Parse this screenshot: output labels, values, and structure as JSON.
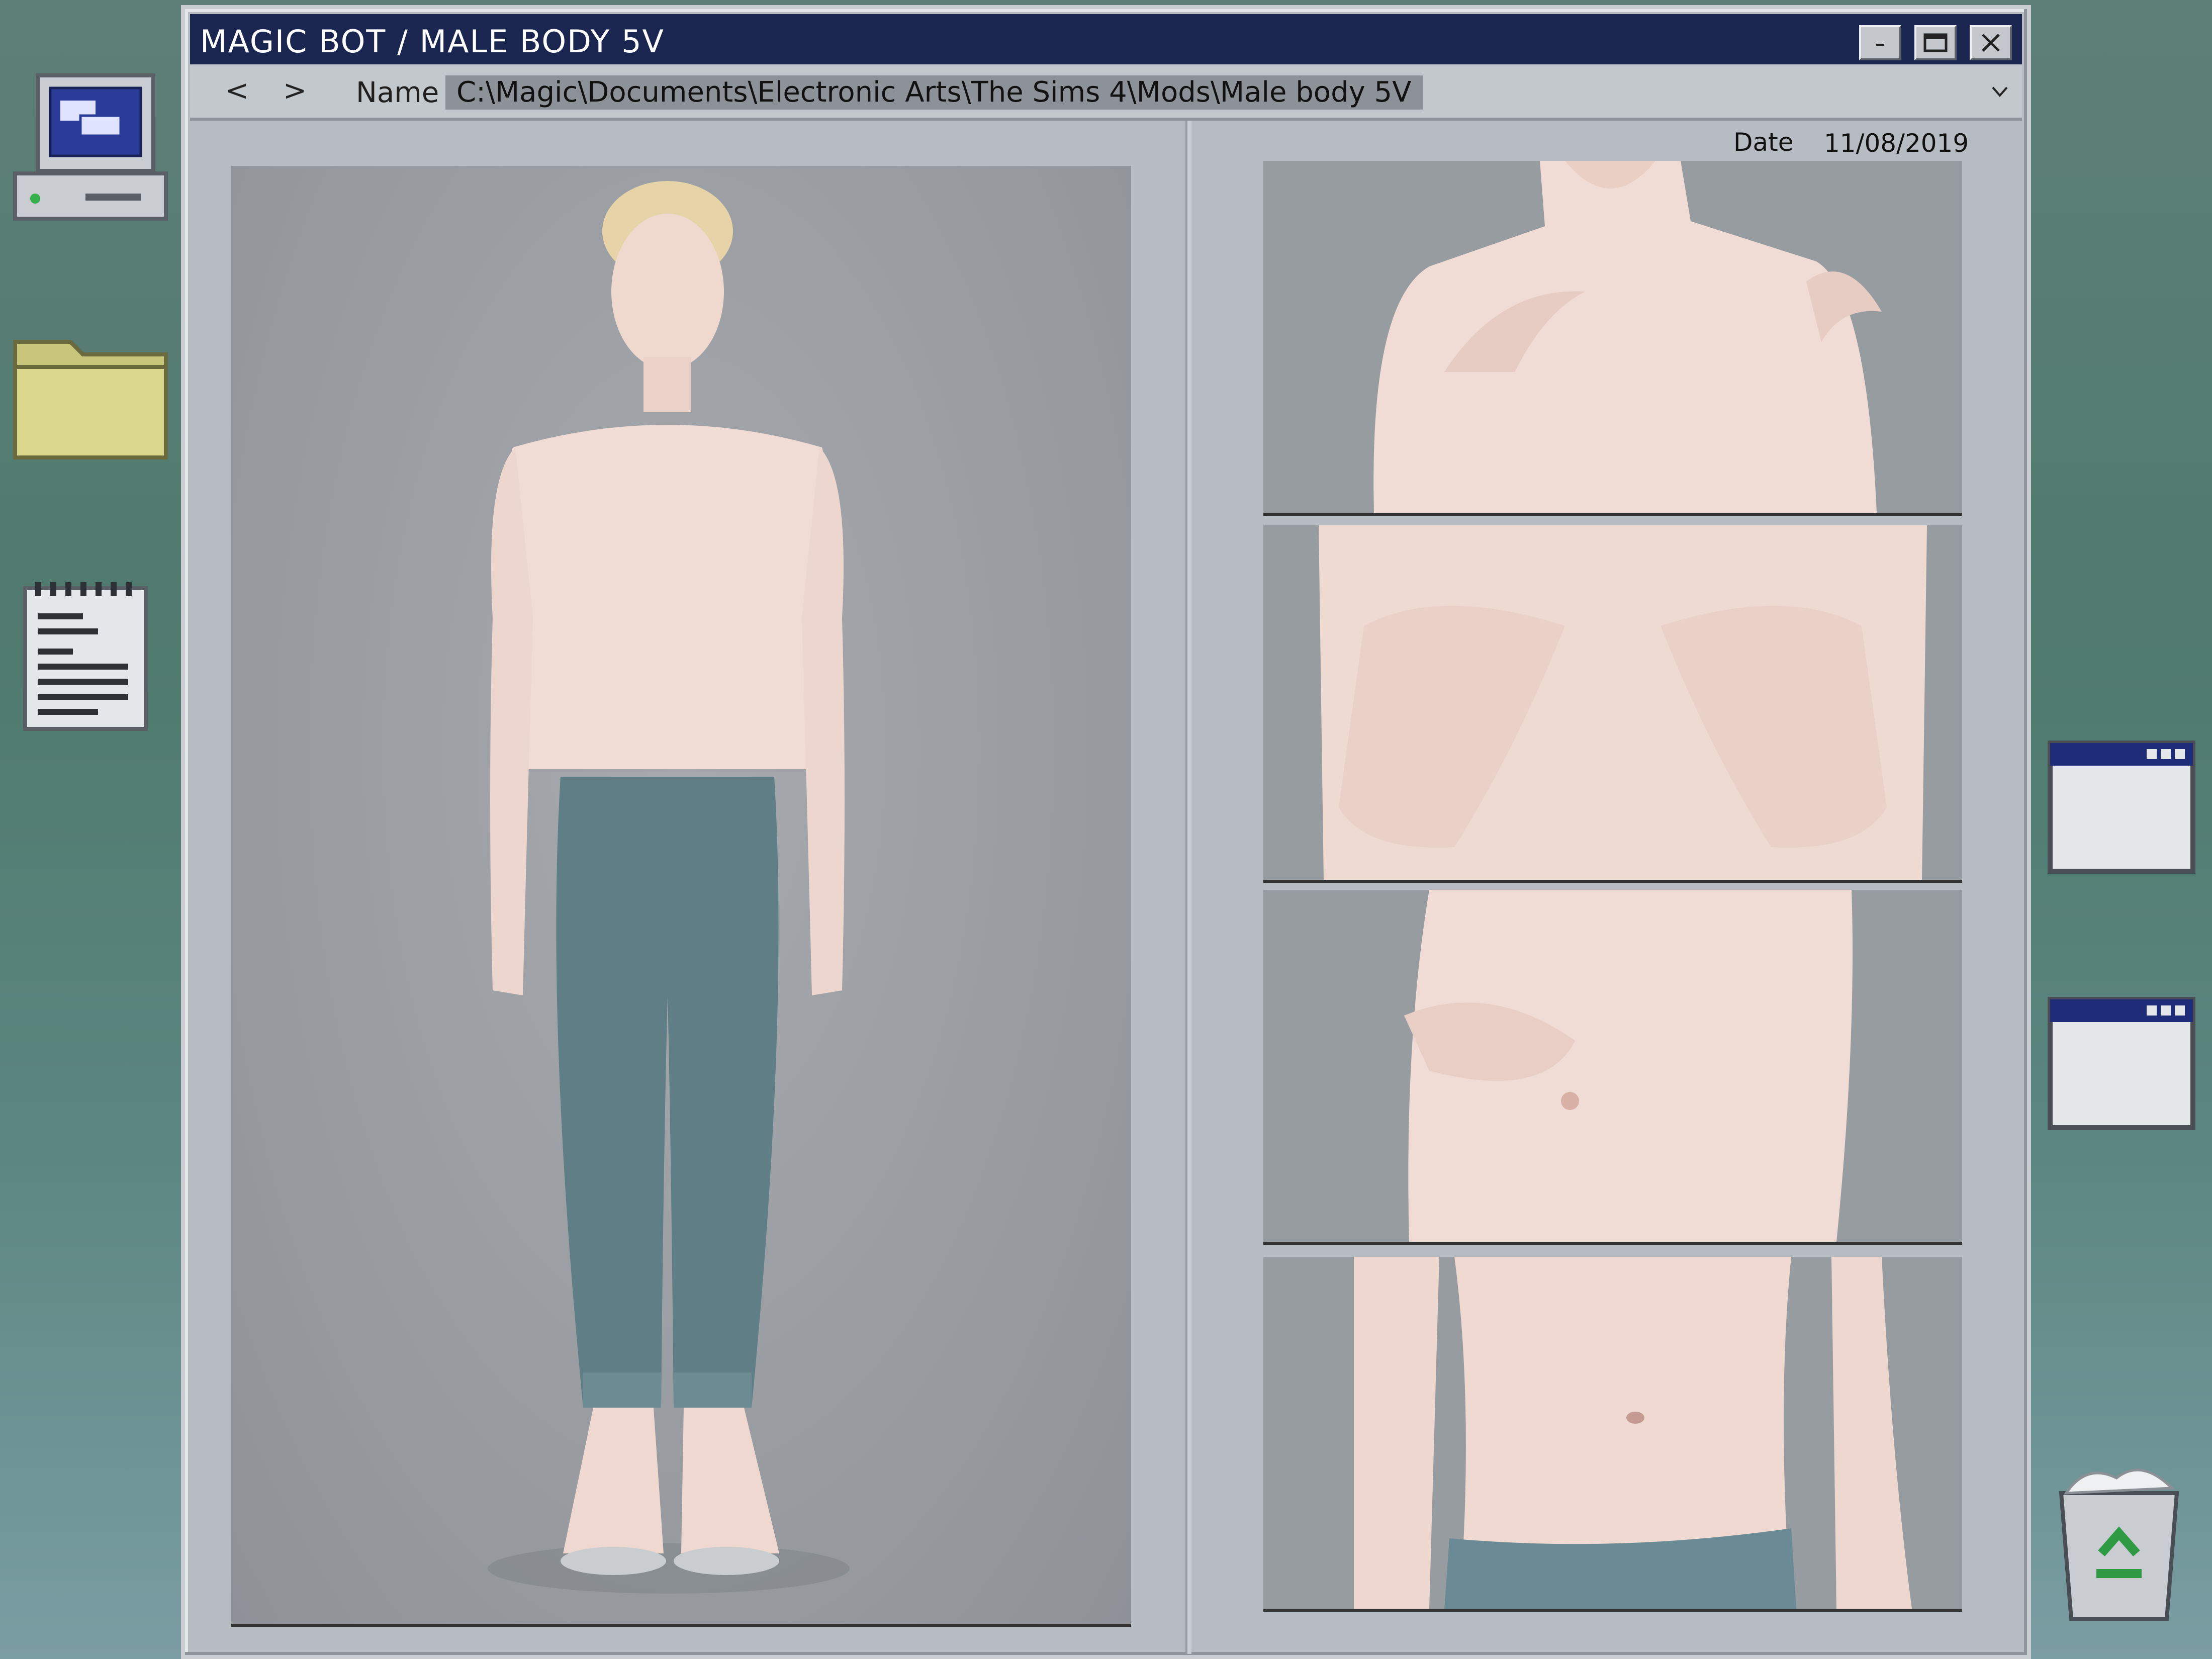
{
  "window": {
    "title": "MAGIC BOT  /  MALE BODY 5V",
    "buttons": {
      "minimize_icon": "minimize-icon",
      "maximize_icon": "maximize-icon",
      "close_icon": "close-icon"
    }
  },
  "address": {
    "back_glyph": "<",
    "forward_glyph": ">",
    "name_label": "Name",
    "path": "C:\\Magic\\Documents\\Electronic Arts\\The Sims 4\\Mods\\Male body 5V"
  },
  "info": {
    "date_label": "Date",
    "date_value": "11/08/2019"
  },
  "desktop_icons": [
    "computer-icon",
    "folder-icon",
    "notepad-icon",
    "window-icon",
    "window-icon",
    "recycle-bin-icon"
  ],
  "colors": {
    "titlebar": "#1a2650",
    "window_body": "#b6bcc1",
    "path_highlight": "#8c9297",
    "folder": "#c8c67a"
  }
}
